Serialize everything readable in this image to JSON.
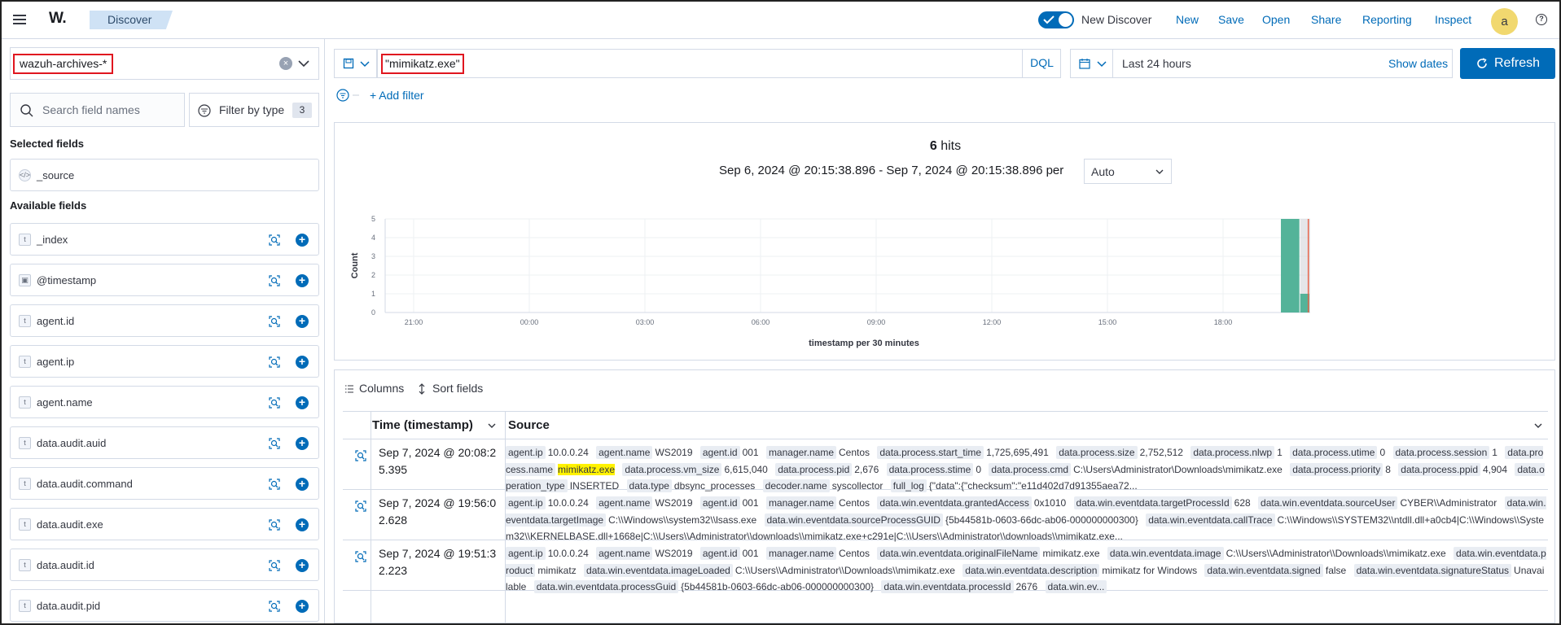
{
  "header": {
    "logo": "W.",
    "breadcrumb": "Discover",
    "new_discover_label": "New Discover",
    "links": [
      "New",
      "Save",
      "Open",
      "Share",
      "Reporting",
      "Inspect"
    ],
    "avatar_initial": "a",
    "help_glyph": "?"
  },
  "sidebar": {
    "index_pattern": "wazuh-archives-*",
    "search_placeholder": "Search field names",
    "filter_by_type_label": "Filter by type",
    "filter_count": "3",
    "selected_title": "Selected fields",
    "selected_fields": [
      {
        "name": "_source",
        "type": "</>"
      }
    ],
    "available_title": "Available fields",
    "available_fields": [
      {
        "name": "_index",
        "type": "t"
      },
      {
        "name": "@timestamp",
        "type": "cal"
      },
      {
        "name": "agent.id",
        "type": "t"
      },
      {
        "name": "agent.ip",
        "type": "t"
      },
      {
        "name": "agent.name",
        "type": "t"
      },
      {
        "name": "data.audit.auid",
        "type": "t"
      },
      {
        "name": "data.audit.command",
        "type": "t"
      },
      {
        "name": "data.audit.exe",
        "type": "t"
      },
      {
        "name": "data.audit.id",
        "type": "t"
      },
      {
        "name": "data.audit.pid",
        "type": "t"
      }
    ]
  },
  "query": {
    "text": "\"mimikatz.exe\"",
    "language": "DQL",
    "time_range": "Last 24 hours",
    "show_dates": "Show dates",
    "refresh": "Refresh",
    "add_filter": "+ Add filter"
  },
  "histogram": {
    "hits_count": "6",
    "hits_label": "hits",
    "range": "Sep 6, 2024 @ 20:15:38.896 - Sep 7, 2024 @ 20:15:38.896 per",
    "interval": "Auto",
    "colors": {
      "bar": "#54b399",
      "marker": "#e7664c",
      "shade": "#d3d6db"
    }
  },
  "chart_data": {
    "type": "bar",
    "ylabel": "Count",
    "xlabel": "timestamp per 30 minutes",
    "ylim": [
      0,
      5
    ],
    "yticks": [
      "0",
      "1",
      "2",
      "3",
      "4",
      "5"
    ],
    "xticks": [
      "21:00",
      "00:00",
      "03:00",
      "06:00",
      "09:00",
      "12:00",
      "15:00",
      "18:00"
    ],
    "x_start_hour": 20.26,
    "x_end_hour": 44.26,
    "bars": [
      {
        "start_hour": 43.5,
        "end_hour": 44.0,
        "value": 5
      },
      {
        "start_hour": 44.0,
        "end_hour": 44.26,
        "value": 1
      }
    ],
    "now_marker_hour": 44.0
  },
  "table": {
    "columns_label": "Columns",
    "sort_label": "Sort fields",
    "col_time": "Time (timestamp)",
    "col_source": "Source",
    "rows": [
      {
        "time": "Sep 7, 2024 @ 20:08:25.395",
        "fields": [
          [
            "agent.ip",
            "10.0.0.24"
          ],
          [
            "agent.name",
            "WS2019"
          ],
          [
            "agent.id",
            "001"
          ],
          [
            "manager.name",
            "Centos"
          ],
          [
            "data.process.start_time",
            "1,725,695,491"
          ],
          [
            "data.process.size",
            "2,752,512"
          ],
          [
            "data.process.nlwp",
            "1"
          ],
          [
            "data.process.utime",
            "0"
          ],
          [
            "data.process.session",
            "1"
          ],
          [
            "data.process.name",
            "mimikatz.exe"
          ],
          [
            "data.process.vm_size",
            "6,615,040"
          ],
          [
            "data.process.pid",
            "2,676"
          ],
          [
            "data.process.stime",
            "0"
          ],
          [
            "data.process.cmd",
            "C:\\Users\\Administrator\\Downloads\\mimikatz.exe"
          ],
          [
            "data.process.priority",
            "8"
          ],
          [
            "data.process.ppid",
            "4,904"
          ],
          [
            "data.operation_type",
            "INSERTED"
          ],
          [
            "data.type",
            "dbsync_processes"
          ],
          [
            "decoder.name",
            "syscollector"
          ],
          [
            "full_log",
            "{\"data\":{\"checksum\":\"e11d402d7d91355aea72..."
          ]
        ],
        "highlight": "mimikatz.exe"
      },
      {
        "time": "Sep 7, 2024 @ 19:56:02.628",
        "fields": [
          [
            "agent.ip",
            "10.0.0.24"
          ],
          [
            "agent.name",
            "WS2019"
          ],
          [
            "agent.id",
            "001"
          ],
          [
            "manager.name",
            "Centos"
          ],
          [
            "data.win.eventdata.grantedAccess",
            "0x1010"
          ],
          [
            "data.win.eventdata.targetProcessId",
            "628"
          ],
          [
            "data.win.eventdata.sourceUser",
            "CYBER\\\\Administrator"
          ],
          [
            "data.win.eventdata.targetImage",
            "C:\\\\Windows\\\\system32\\\\lsass.exe"
          ],
          [
            "data.win.eventdata.sourceProcessGUID",
            "{5b44581b-0603-66dc-ab06-000000000300}"
          ],
          [
            "data.win.eventdata.callTrace",
            "C:\\\\Windows\\\\SYSTEM32\\\\ntdll.dll+a0cb4|C:\\\\Windows\\\\System32\\\\KERNELBASE.dll+1668e|C:\\\\Users\\\\Administrator\\\\downloads\\\\mimikatz.exe+c291e|C:\\\\Users\\\\Administrator\\\\downloads\\\\mimikatz.exe..."
          ]
        ],
        "highlight": ""
      },
      {
        "time": "Sep 7, 2024 @ 19:51:32.223",
        "fields": [
          [
            "agent.ip",
            "10.0.0.24"
          ],
          [
            "agent.name",
            "WS2019"
          ],
          [
            "agent.id",
            "001"
          ],
          [
            "manager.name",
            "Centos"
          ],
          [
            "data.win.eventdata.originalFileName",
            "mimikatz.exe"
          ],
          [
            "data.win.eventdata.image",
            "C:\\\\Users\\\\Administrator\\\\Downloads\\\\mimikatz.exe"
          ],
          [
            "data.win.eventdata.product",
            "mimikatz"
          ],
          [
            "data.win.eventdata.imageLoaded",
            "C:\\\\Users\\\\Administrator\\\\Downloads\\\\mimikatz.exe"
          ],
          [
            "data.win.eventdata.description",
            "mimikatz for Windows"
          ],
          [
            "data.win.eventdata.signed",
            "false"
          ],
          [
            "data.win.eventdata.signatureStatus",
            "Unavailable"
          ],
          [
            "data.win.eventdata.processGuid",
            "{5b44581b-0603-66dc-ab06-000000000300}"
          ],
          [
            "data.win.eventdata.processId",
            "2676"
          ],
          [
            "data.win.ev...",
            ""
          ]
        ],
        "highlight": ""
      }
    ]
  }
}
